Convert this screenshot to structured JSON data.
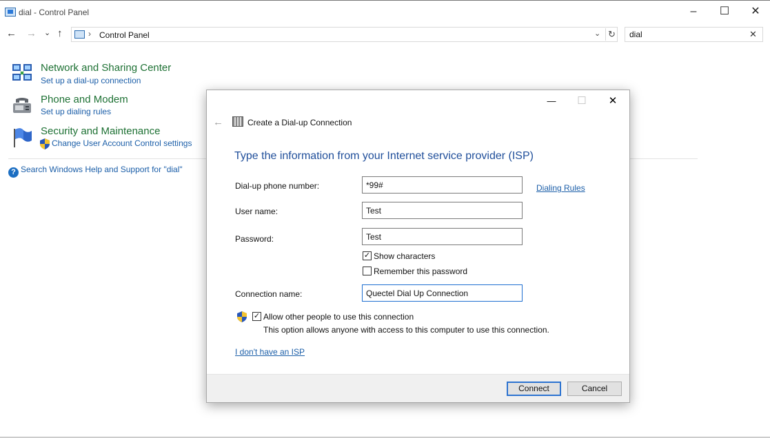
{
  "window": {
    "title": "dial - Control Panel",
    "minimize_glyph": "–",
    "maximize_glyph": "☐",
    "close_glyph": "✕"
  },
  "navigation": {
    "back_glyph": "←",
    "forward_glyph": "→",
    "recent_glyph": "⌄",
    "up_glyph": "↑",
    "address_separator": "›",
    "address_crumb": "Control Panel",
    "address_dropdown_glyph": "⌄",
    "refresh_glyph": "↻",
    "search_value": "dial",
    "search_clear_glyph": "✕"
  },
  "results": [
    {
      "heading": "Network and Sharing Center",
      "links": [
        "Set up a dial-up connection"
      ],
      "icon": "network-sharing-icon"
    },
    {
      "heading": "Phone and Modem",
      "links": [
        "Set up dialing rules"
      ],
      "icon": "phone-modem-icon"
    },
    {
      "heading": "Security and Maintenance",
      "links": [
        "Change User Account Control settings"
      ],
      "icon": "security-flag-icon"
    }
  ],
  "help_link": "Search Windows Help and Support for \"dial\"",
  "dialog": {
    "title": "Create a Dial-up Connection",
    "heading": "Type the information from your Internet service provider (ISP)",
    "fields": {
      "phone_label": "Dial-up phone number:",
      "phone_value": "*99#",
      "dialing_rules_link": "Dialing Rules",
      "username_label": "User name:",
      "username_value": "Test",
      "password_label": "Password:",
      "password_value": "Test",
      "show_characters_label": "Show characters",
      "show_characters_checked": true,
      "remember_password_label": "Remember this password",
      "remember_password_checked": false,
      "connection_name_label": "Connection name:",
      "connection_name_value": "Quectel Dial Up Connection",
      "allow_others_label": "Allow other people to use this connection",
      "allow_others_checked": true,
      "allow_others_description": "This option allows anyone with access to this computer to use this connection.",
      "no_isp_link": "I don't have an ISP"
    },
    "buttons": {
      "connect": "Connect",
      "cancel": "Cancel"
    },
    "controls": {
      "minimize_glyph": "—",
      "maximize_glyph": "☐",
      "close_glyph": "✕",
      "back_glyph": "←",
      "check_glyph": "✓"
    }
  },
  "colors": {
    "heading_green": "#1e7134",
    "link_blue": "#1b5ea8",
    "dialog_heading_blue": "#1f4e9a",
    "default_button_border": "#2b72d0"
  }
}
